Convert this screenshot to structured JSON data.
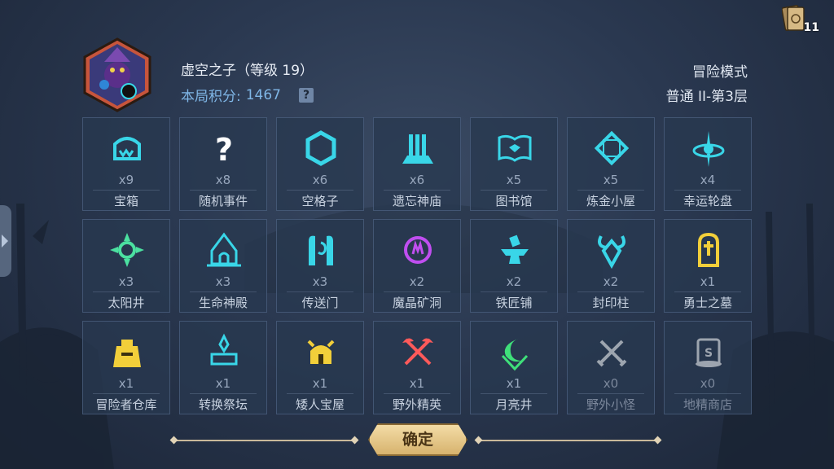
{
  "hud": {
    "card_count": "11"
  },
  "player": {
    "name": "虚空之子（等级 19）",
    "score_label": "本局积分:",
    "score_value": "1467",
    "help": "?"
  },
  "mode": {
    "title": "冒险模式",
    "level": "普通 II-第3层"
  },
  "items": [
    {
      "count": "x9",
      "name": "宝箱",
      "icon": "chest-icon",
      "color": "#39d6e8"
    },
    {
      "count": "x8",
      "name": "随机事件",
      "icon": "question-icon",
      "color": "#ffffff"
    },
    {
      "count": "x6",
      "name": "空格子",
      "icon": "hexagon-icon",
      "color": "#39d6e8"
    },
    {
      "count": "x6",
      "name": "遗忘神庙",
      "icon": "temple-icon",
      "color": "#39d6e8"
    },
    {
      "count": "x5",
      "name": "图书馆",
      "icon": "book-icon",
      "color": "#39d6e8"
    },
    {
      "count": "x5",
      "name": "炼金小屋",
      "icon": "alchemy-icon",
      "color": "#39d6e8"
    },
    {
      "count": "x4",
      "name": "幸运轮盘",
      "icon": "wheel-icon",
      "color": "#39d6e8"
    },
    {
      "count": "x3",
      "name": "太阳井",
      "icon": "sun-icon",
      "color": "#4be0a0"
    },
    {
      "count": "x3",
      "name": "生命神殿",
      "icon": "shrine-icon",
      "color": "#39d6e8"
    },
    {
      "count": "x3",
      "name": "传送门",
      "icon": "portal-icon",
      "color": "#39d6e8"
    },
    {
      "count": "x2",
      "name": "魔晶矿洞",
      "icon": "crystal-icon",
      "color": "#c04ef0"
    },
    {
      "count": "x2",
      "name": "铁匠铺",
      "icon": "anvil-icon",
      "color": "#39d6e8"
    },
    {
      "count": "x2",
      "name": "封印柱",
      "icon": "seal-icon",
      "color": "#39d6e8"
    },
    {
      "count": "x1",
      "name": "勇士之墓",
      "icon": "tomb-icon",
      "color": "#f2cf3a"
    },
    {
      "count": "x1",
      "name": "冒险者仓库",
      "icon": "warehouse-icon",
      "color": "#f2cf3a"
    },
    {
      "count": "x1",
      "name": "转换祭坛",
      "icon": "altar-icon",
      "color": "#39d6e8"
    },
    {
      "count": "x1",
      "name": "矮人宝屋",
      "icon": "dwarf-icon",
      "color": "#f2cf3a"
    },
    {
      "count": "x1",
      "name": "野外精英",
      "icon": "crossed-axes-icon",
      "color": "#ff5a5a"
    },
    {
      "count": "x1",
      "name": "月亮井",
      "icon": "moon-icon",
      "color": "#3fe07a"
    },
    {
      "count": "x0",
      "name": "野外小怪",
      "icon": "crossed-swords-icon",
      "color": "#ffffff",
      "dim": true
    },
    {
      "count": "x0",
      "name": "地精商店",
      "icon": "shop-icon",
      "color": "#ffffff",
      "dim": true
    }
  ],
  "confirm": "确定"
}
